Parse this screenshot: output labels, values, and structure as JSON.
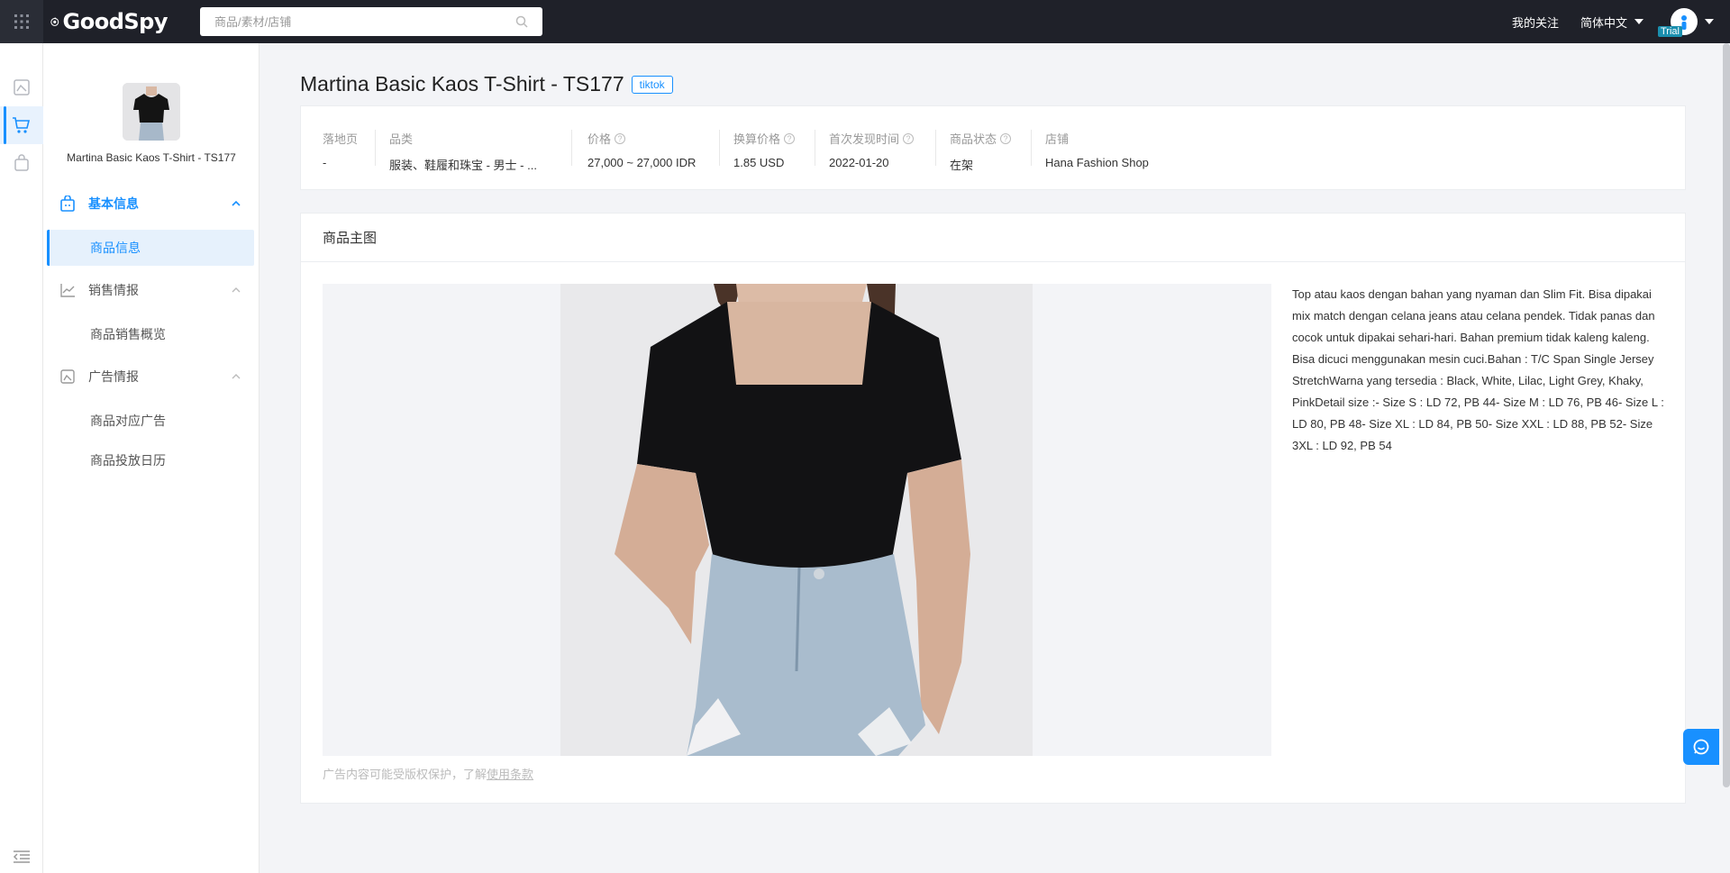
{
  "topbar": {
    "logo_text": "GoodSpy",
    "search_placeholder": "商品/素材/店铺",
    "my_follow": "我的关注",
    "language": "简体中文",
    "trial_badge": "Trial"
  },
  "sidebar": {
    "product_name": "Martina Basic Kaos T-Shirt - TS177",
    "groups": [
      {
        "label": "基本信息",
        "items": [
          "商品信息"
        ]
      },
      {
        "label": "销售情报",
        "items": [
          "商品销售概览"
        ]
      },
      {
        "label": "广告情报",
        "items": [
          "商品对应广告",
          "商品投放日历"
        ]
      }
    ]
  },
  "product": {
    "title": "Martina Basic Kaos T-Shirt - TS177",
    "platform_tag": "tiktok"
  },
  "info": {
    "landing_label": "落地页",
    "landing_value": "-",
    "category_label": "品类",
    "category_value": "服装、鞋履和珠宝 - 男士 - ...",
    "price_label": "价格",
    "price_value": "27,000 ~ 27,000 IDR",
    "converted_label": "换算价格",
    "converted_value": "1.85 USD",
    "first_seen_label": "首次发现时间",
    "first_seen_value": "2022-01-20",
    "status_label": "商品状态",
    "status_value": "在架",
    "shop_label": "店铺",
    "shop_value": "Hana Fashion Shop"
  },
  "main_image": {
    "section_title": "商品主图",
    "description": "Top atau kaos dengan bahan yang nyaman dan Slim Fit. Bisa dipakai mix match dengan celana jeans atau celana pendek. Tidak panas dan cocok untuk dipakai sehari-hari. Bahan premium tidak kaleng kaleng. Bisa dicuci menggunakan mesin cuci.Bahan : T/C Span Single Jersey StretchWarna yang tersedia : Black, White, Lilac, Light Grey, Khaky, PinkDetail size :- Size S : LD 72, PB 44- Size M : LD 76, PB 46- Size L : LD 80, PB 48- Size XL : LD 84, PB 50- Size XXL : LD 88, PB 52- Size 3XL : LD 92, PB 54",
    "copyright_text": "广告内容可能受版权保护，了解",
    "copyright_link": "使用条款"
  },
  "colors": {
    "accent": "#1890ff",
    "topbar": "#1f2129"
  }
}
